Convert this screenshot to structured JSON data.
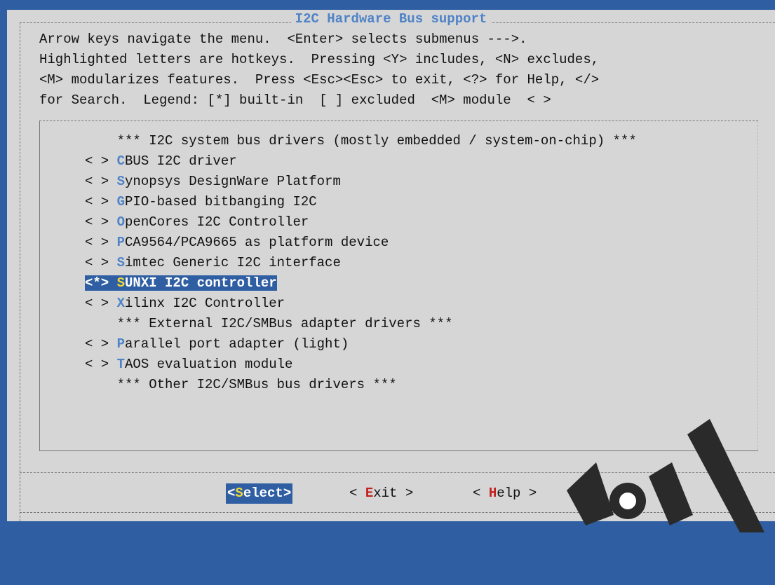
{
  "dialog": {
    "title": "I2C Hardware Bus support",
    "intro_lines": [
      "Arrow keys navigate the menu.  <Enter> selects submenus --->.",
      "Highlighted letters are hotkeys.  Pressing <Y> includes, <N> excludes,",
      "<M> modularizes features.  Press <Esc><Esc> to exit, <?> for Help, </>",
      "for Search.  Legend: [*] built-in  [ ] excluded  <M> module  < >"
    ]
  },
  "menu": {
    "items": [
      {
        "prefix": "    ",
        "hotkey": "",
        "rest": "*** I2C system bus drivers (mostly embedded / system-on-chip) ***",
        "type": "comment"
      },
      {
        "prefix": "< > ",
        "hotkey": "C",
        "rest": "BUS I2C driver",
        "type": "option"
      },
      {
        "prefix": "< > ",
        "hotkey": "S",
        "rest": "ynopsys DesignWare Platform",
        "type": "option"
      },
      {
        "prefix": "< > ",
        "hotkey": "G",
        "rest": "PIO-based bitbanging I2C",
        "type": "option"
      },
      {
        "prefix": "< > ",
        "hotkey": "O",
        "rest": "penCores I2C Controller",
        "type": "option"
      },
      {
        "prefix": "< > ",
        "hotkey": "P",
        "rest": "CA9564/PCA9665 as platform device",
        "type": "option"
      },
      {
        "prefix": "< > ",
        "hotkey": "S",
        "rest": "imtec Generic I2C interface",
        "type": "option"
      },
      {
        "prefix": "<*> ",
        "hotkey": "S",
        "rest": "UNXI I2C controller",
        "type": "selected"
      },
      {
        "prefix": "< > ",
        "hotkey": "X",
        "rest": "ilinx I2C Controller",
        "type": "option"
      },
      {
        "prefix": "    ",
        "hotkey": "",
        "rest": "*** External I2C/SMBus adapter drivers ***",
        "type": "comment"
      },
      {
        "prefix": "< > ",
        "hotkey": "P",
        "rest": "arallel port adapter (light)",
        "type": "option"
      },
      {
        "prefix": "< > ",
        "hotkey": "T",
        "rest": "AOS evaluation module",
        "type": "option"
      },
      {
        "prefix": "    ",
        "hotkey": "",
        "rest": "*** Other I2C/SMBus bus drivers ***",
        "type": "comment"
      }
    ]
  },
  "buttons": {
    "select": {
      "pre": "<",
      "hotkey": "S",
      "post": "elect>"
    },
    "exit": {
      "pre": "< ",
      "hotkey": "E",
      "post": "xit >"
    },
    "help": {
      "pre": "< ",
      "hotkey": "H",
      "post": "elp >"
    }
  },
  "colors": {
    "background": "#2f5fa2",
    "dialog": "#d6d6d6",
    "highlight": "#2f5fa2",
    "hotkey": "#4f83c7",
    "button_hotkey": "#c21f1f",
    "selected_hotkey": "#f0d838"
  }
}
